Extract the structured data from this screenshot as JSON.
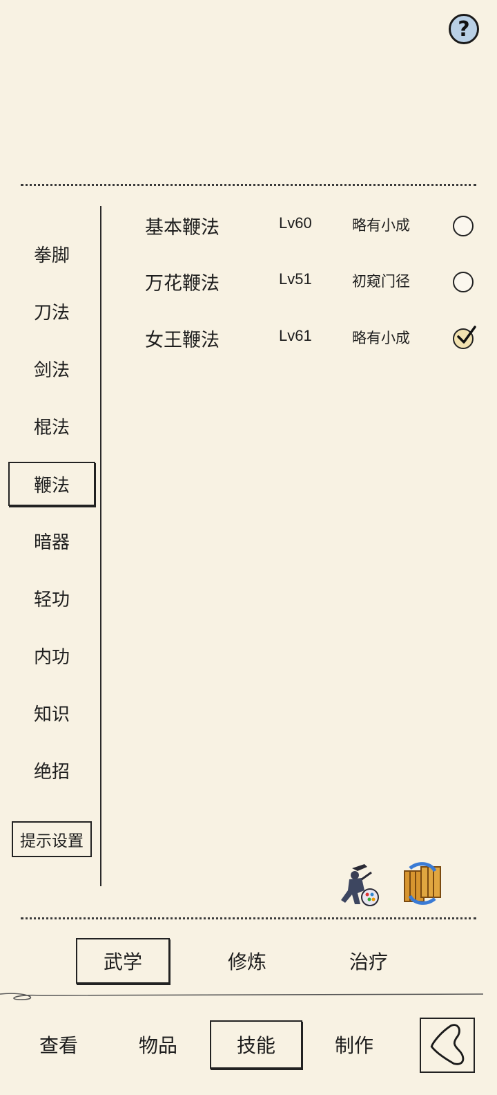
{
  "header": {
    "help_icon": "question-mark-icon",
    "help_label": "?"
  },
  "categories": [
    {
      "label": "拳脚",
      "active": false
    },
    {
      "label": "刀法",
      "active": false
    },
    {
      "label": "剑法",
      "active": false
    },
    {
      "label": "棍法",
      "active": false
    },
    {
      "label": "鞭法",
      "active": true
    },
    {
      "label": "暗器",
      "active": false
    },
    {
      "label": "轻功",
      "active": false
    },
    {
      "label": "内功",
      "active": false
    },
    {
      "label": "知识",
      "active": false
    },
    {
      "label": "绝招",
      "active": false
    }
  ],
  "hint_settings_label": "提示设置",
  "skills": [
    {
      "name": "基本鞭法",
      "level": "Lv60",
      "stage": "略有小成",
      "selected": false
    },
    {
      "name": "万花鞭法",
      "level": "Lv51",
      "stage": "初窥门径",
      "selected": false
    },
    {
      "name": "女王鞭法",
      "level": "Lv61",
      "stage": "略有小成",
      "selected": true
    }
  ],
  "action_icons": [
    "martial-artist-icon",
    "swap-scroll-icon"
  ],
  "sub_tabs": [
    {
      "label": "武学",
      "active": true
    },
    {
      "label": "修炼",
      "active": false
    },
    {
      "label": "治疗",
      "active": false
    }
  ],
  "nav_tabs": [
    {
      "label": "查看",
      "active": false
    },
    {
      "label": "物品",
      "active": false
    },
    {
      "label": "技能",
      "active": true
    },
    {
      "label": "制作",
      "active": false
    }
  ],
  "back_icon": "back-arrow-icon",
  "colors": {
    "background": "#f8f2e3",
    "ink": "#1d1d1d",
    "help_button": "#b9d0e6"
  }
}
